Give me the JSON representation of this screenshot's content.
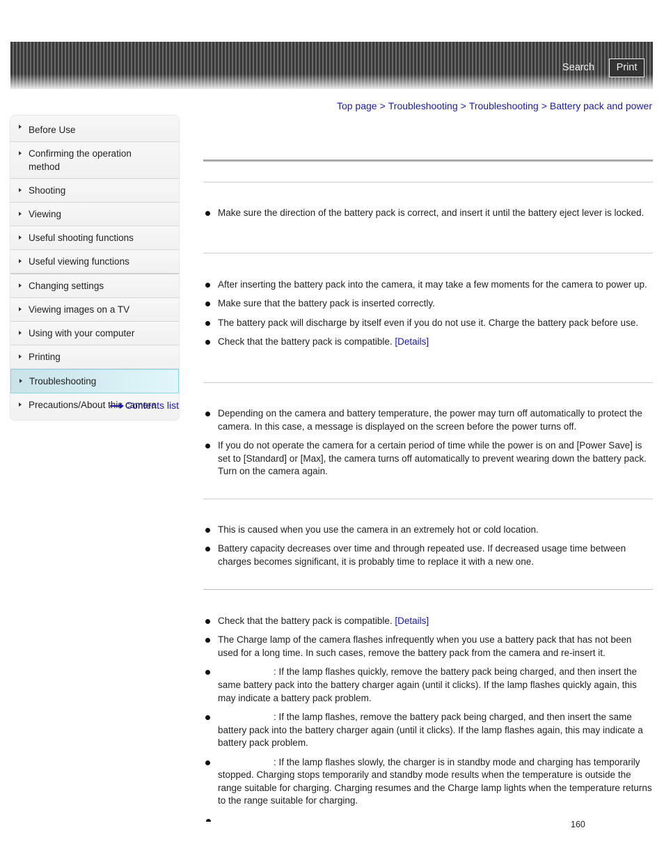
{
  "header": {
    "search_label": "Search",
    "print_label": "Print"
  },
  "breadcrumb": {
    "items": [
      "Top page",
      "Troubleshooting",
      "Troubleshooting",
      "Battery pack and power"
    ],
    "separator": ">"
  },
  "sidebar": {
    "items": [
      {
        "label": "Before Use"
      },
      {
        "label": "Confirming the operation method"
      },
      {
        "label": "Shooting"
      },
      {
        "label": "Viewing"
      },
      {
        "label": "Useful shooting functions"
      },
      {
        "label": "Useful viewing functions"
      },
      {
        "label": "Changing settings"
      },
      {
        "label": "Viewing images on a TV"
      },
      {
        "label": "Using with your computer"
      },
      {
        "label": "Printing"
      },
      {
        "label": "Troubleshooting",
        "active": true
      },
      {
        "label": "Precautions/About this camera"
      }
    ],
    "contents_link": "Contents list"
  },
  "sections": [
    {
      "bullets": [
        "Make sure the direction of the battery pack is correct, and insert it until the battery eject lever is locked."
      ]
    },
    {
      "bullets": [
        "After inserting the battery pack into the camera, it may take a few moments for the camera to power up.",
        "Make sure that the battery pack is inserted correctly.",
        "The battery pack will discharge by itself even if you do not use it. Charge the battery pack before use.",
        "Check that the battery pack is compatible."
      ],
      "details_link": "[Details]"
    },
    {
      "bullets": [
        "Depending on the camera and battery temperature, the power may turn off automatically to protect the camera. In this case, a message is displayed on the screen before the power turns off.",
        "If you do not operate the camera for a certain period of time while the power is on and [Power Save] is set to [Standard] or [Max], the camera turns off automatically to prevent wearing down the battery pack. Turn on the camera again."
      ]
    },
    {
      "bullets": [
        "This is caused when you use the camera in an extremely hot or cold location.",
        "Battery capacity decreases over time and through repeated use. If decreased usage time between charges becomes significant, it is probably time to replace it with a new one."
      ]
    },
    {
      "bullets": [
        "Check that the battery pack is compatible.",
        "The Charge lamp of the camera flashes infrequently when you use a battery pack that has not been used for a long time. In such cases, remove the battery pack from the camera and re-insert it.",
        ": If the lamp flashes quickly, remove the battery pack being charged, and then insert the same battery pack into the battery charger again (until it clicks). If the lamp flashes quickly again, this may indicate a battery pack problem.",
        ": If the lamp flashes, remove the battery pack being charged, and then insert the same battery pack into the battery charger again (until it clicks). If the lamp flashes again, this may indicate a battery pack problem.",
        ": If the lamp flashes slowly, the charger is in standby mode and charging has temporarily stopped. Charging stops temporarily and standby mode results when the temperature is outside the range suitable for charging. Charging resumes and the Charge lamp lights when the temperature returns to the range suitable for charging."
      ],
      "details_link": "[Details]"
    }
  ],
  "page_number": "160"
}
